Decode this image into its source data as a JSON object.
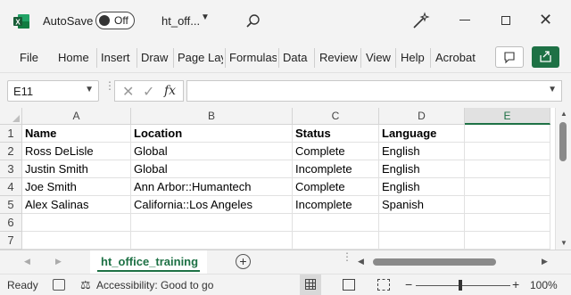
{
  "titlebar": {
    "autosave_label": "AutoSave",
    "toggle_state": "Off",
    "filename": "ht_off...",
    "brand_color": "#1e7145"
  },
  "ribbon": {
    "tabs": [
      "File",
      "Home",
      "Insert",
      "Draw",
      "Page Lay",
      "Formulas",
      "Data",
      "Review",
      "View",
      "Help",
      "Acrobat"
    ]
  },
  "formula_bar": {
    "name_box": "E11",
    "formula": ""
  },
  "grid": {
    "columns": [
      "A",
      "B",
      "C",
      "D",
      "E"
    ],
    "active_column": "E",
    "row_numbers": [
      "1",
      "2",
      "3",
      "4",
      "5",
      "6",
      "7"
    ],
    "rows": [
      [
        "Name",
        "Location",
        "Status",
        "Language",
        ""
      ],
      [
        "Ross DeLisle",
        "Global",
        "Complete",
        "English",
        ""
      ],
      [
        "Justin Smith",
        "Global",
        "Incomplete",
        "English",
        ""
      ],
      [
        "Joe Smith",
        "Ann Arbor::Humantech",
        "Complete",
        "English",
        ""
      ],
      [
        "Alex Salinas",
        "California::Los Angeles",
        "Incomplete",
        "Spanish",
        ""
      ],
      [
        "",
        "",
        "",
        "",
        ""
      ],
      [
        "",
        "",
        "",
        "",
        ""
      ]
    ]
  },
  "sheets": {
    "active": "ht_office_training"
  },
  "status": {
    "ready": "Ready",
    "accessibility": "Accessibility: Good to go",
    "zoom": "100%"
  }
}
